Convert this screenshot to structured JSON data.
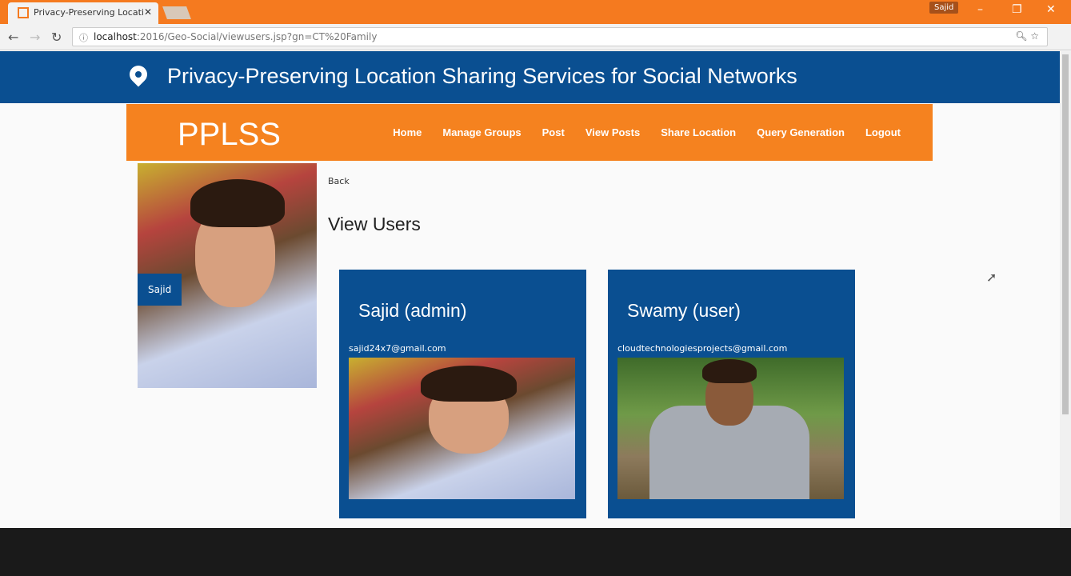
{
  "browser": {
    "tab_title": "Privacy-Preserving Locati",
    "profile": "Sajid",
    "url_host": "localhost",
    "url_path": ":2016/Geo-Social/viewusers.jsp?gn=CT%20Family"
  },
  "header": {
    "title": "Privacy-Preserving Location Sharing Services for Social Networks"
  },
  "nav": {
    "brand": "PPLSS",
    "items": [
      "Home",
      "Manage Groups",
      "Post",
      "View Posts",
      "Share Location",
      "Query Generation",
      "Logout"
    ]
  },
  "profile": {
    "name": "Sajid"
  },
  "main": {
    "back": "Back",
    "title": "View Users",
    "users": [
      {
        "name": "Sajid (admin)",
        "email": "sajid24x7@gmail.com"
      },
      {
        "name": "Swamy (user)",
        "email": "cloudtechnologiesprojects@gmail.com"
      }
    ]
  }
}
